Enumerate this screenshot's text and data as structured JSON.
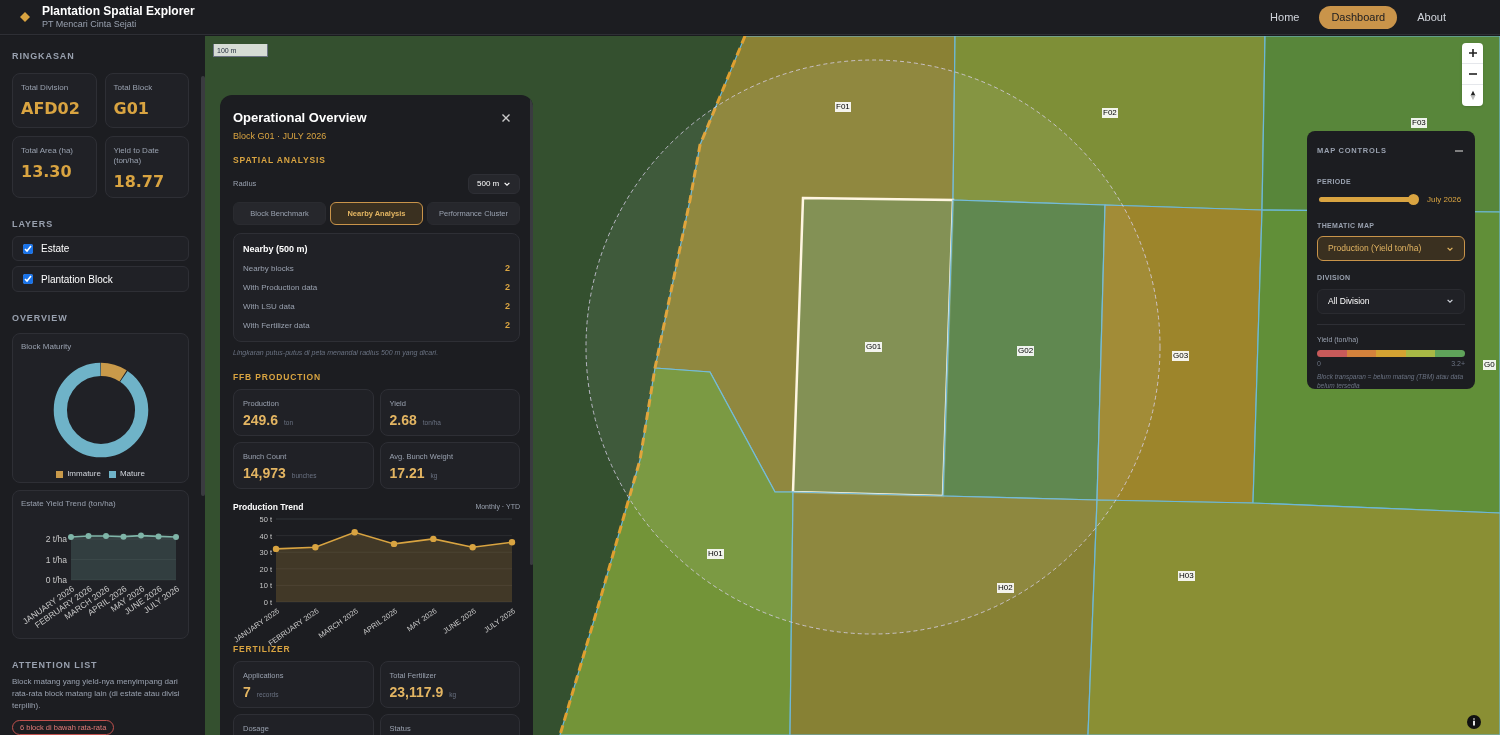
{
  "header": {
    "title": "Plantation Spatial Explorer",
    "subtitle": "PT Mencari Cinta Sejati",
    "nav": [
      {
        "label": "Home",
        "selected": false
      },
      {
        "label": "Dashboard",
        "selected": true
      },
      {
        "label": "About",
        "selected": false
      }
    ]
  },
  "sidebar": {
    "summary_title": "RINGKASAN",
    "stats": [
      {
        "label": "Total Division",
        "value": "AFD02"
      },
      {
        "label": "Total Block",
        "value": "G01"
      },
      {
        "label": "Total Area (ha)",
        "value": "13.30"
      },
      {
        "label": "Yield to Date (ton/ha)",
        "value": "18.77"
      }
    ],
    "layers_title": "LAYERS",
    "layers": [
      {
        "label": "Estate",
        "checked": true
      },
      {
        "label": "Plantation Block",
        "checked": true
      }
    ],
    "overview_title": "OVERVIEW",
    "maturity": {
      "title": "Block Maturity",
      "legend": [
        {
          "label": "Immature",
          "color": "#c99a4a"
        },
        {
          "label": "Mature",
          "color": "#6fb3c8"
        }
      ]
    },
    "yield_trend": {
      "title": "Estate Yield Trend (ton/ha)",
      "chart_data": {
        "type": "area",
        "categories": [
          "JANUARY 2026",
          "FEBRUARY 2026",
          "MARCH 2026",
          "APRIL 2026",
          "MAY 2026",
          "JUNE 2026",
          "JULY 2026"
        ],
        "series": [
          {
            "color": "#7fb5a8",
            "values": [
              2.1,
              2.15,
              2.15,
              2.12,
              2.17,
              2.13,
              2.1
            ]
          }
        ],
        "grid": true,
        "ylim": [
          0,
          2.2
        ],
        "yticks": [
          {
            "value": 0,
            "label": "0 t/ha"
          },
          {
            "value": 1,
            "label": "1 t/ha"
          },
          {
            "value": 2,
            "label": "2 t/ha"
          }
        ]
      }
    },
    "attention": {
      "title": "ATTENTION LIST",
      "text": "Block matang yang yield-nya menyimpang dari rata-rata block matang lain (di estate atau divisi terpilih).",
      "badge": "6 block di bawah rata-rata"
    }
  },
  "map": {
    "scale": "100 m",
    "blocks": [
      {
        "label": "F01",
        "color": "#9a8a35",
        "selected": false
      },
      {
        "label": "F02",
        "color": "#8c9a38",
        "selected": false
      },
      {
        "label": "F03",
        "color": "#5f8f3c",
        "selected": false
      },
      {
        "label": "G01",
        "color": "#8a9550",
        "selected": true
      },
      {
        "label": "G02",
        "color": "#5e8a4a",
        "selected": false
      },
      {
        "label": "G03",
        "color": "#b08e2a",
        "selected": false
      },
      {
        "label": "G0",
        "color": "#6a9a3a",
        "selected": false
      },
      {
        "label": "H01",
        "color": "#7fa03a",
        "selected": false
      },
      {
        "label": "H02",
        "color": "#978a35",
        "selected": false
      },
      {
        "label": "H03",
        "color": "#9a9a35",
        "selected": false
      }
    ]
  },
  "overview_panel": {
    "title": "Operational Overview",
    "subtitle": "Block G01 · JULY 2026",
    "spatial_title": "SPATIAL ANALYSIS",
    "radius_label": "Radius",
    "radius_value": "500 m",
    "tabs": [
      {
        "label": "Block Benchmark",
        "selected": false
      },
      {
        "label": "Nearby Analysis",
        "selected": true
      },
      {
        "label": "Performance Cluster",
        "selected": false
      }
    ],
    "nearby": {
      "title": "Nearby (500 m)",
      "rows": [
        {
          "label": "Nearby blocks",
          "value": "2"
        },
        {
          "label": "With Production data",
          "value": "2"
        },
        {
          "label": "With LSU data",
          "value": "2"
        },
        {
          "label": "With Fertilizer data",
          "value": "2"
        }
      ]
    },
    "note": "Lingkaran putus-putus di peta menandai radius 500 m yang dicari.",
    "ffb_title": "FFB PRODUCTION",
    "ffb_stats": [
      {
        "label": "Production",
        "value": "249.6",
        "unit": "ton"
      },
      {
        "label": "Yield",
        "value": "2.68",
        "unit": "ton/ha"
      },
      {
        "label": "Bunch Count",
        "value": "14,973",
        "unit": "bunches"
      },
      {
        "label": "Avg. Bunch Weight",
        "value": "17.21",
        "unit": "kg"
      }
    ],
    "trend": {
      "title": "Production Trend",
      "period": "Monthly · YTD",
      "chart_data": {
        "type": "area",
        "categories": [
          "JANUARY 2026",
          "FEBRUARY 2026",
          "MARCH 2026",
          "APRIL 2026",
          "MAY 2026",
          "JUNE 2026",
          "JULY 2026"
        ],
        "series": [
          {
            "color": "#d9a441",
            "values": [
              32,
              33,
              42,
              35,
              38,
              33,
              36
            ]
          }
        ],
        "grid": true,
        "ylim": [
          0,
          50
        ],
        "yticks": [
          {
            "value": 0,
            "label": "0 t"
          },
          {
            "value": 10,
            "label": "10 t"
          },
          {
            "value": 20,
            "label": "20 t"
          },
          {
            "value": 30,
            "label": "30 t"
          },
          {
            "value": 40,
            "label": "40 t"
          },
          {
            "value": 50,
            "label": "50 t"
          }
        ]
      }
    },
    "fert_title": "FERTILIZER",
    "fert_stats": [
      {
        "label": "Applications",
        "value": "7",
        "unit": "records"
      },
      {
        "label": "Total Fertilizer",
        "value": "23,117.9",
        "unit": "kg"
      },
      {
        "label": "Dosage"
      },
      {
        "label": "Status"
      }
    ]
  },
  "map_controls": {
    "title": "MAP CONTROLS",
    "period_label": "PERIODE",
    "period_slider": {
      "level": 1
    },
    "period_value": "July 2026",
    "thematic_label": "THEMATIC MAP",
    "thematic_value": "Production (Yield ton/ha)",
    "division_label": "DIVISION",
    "division_value": "All Division",
    "legend_title": "Yield (ton/ha)",
    "legend_min": "0",
    "legend_max": "3.2+",
    "note": "Block transparan = belum matang (TBM) atau data belum tersedia"
  }
}
